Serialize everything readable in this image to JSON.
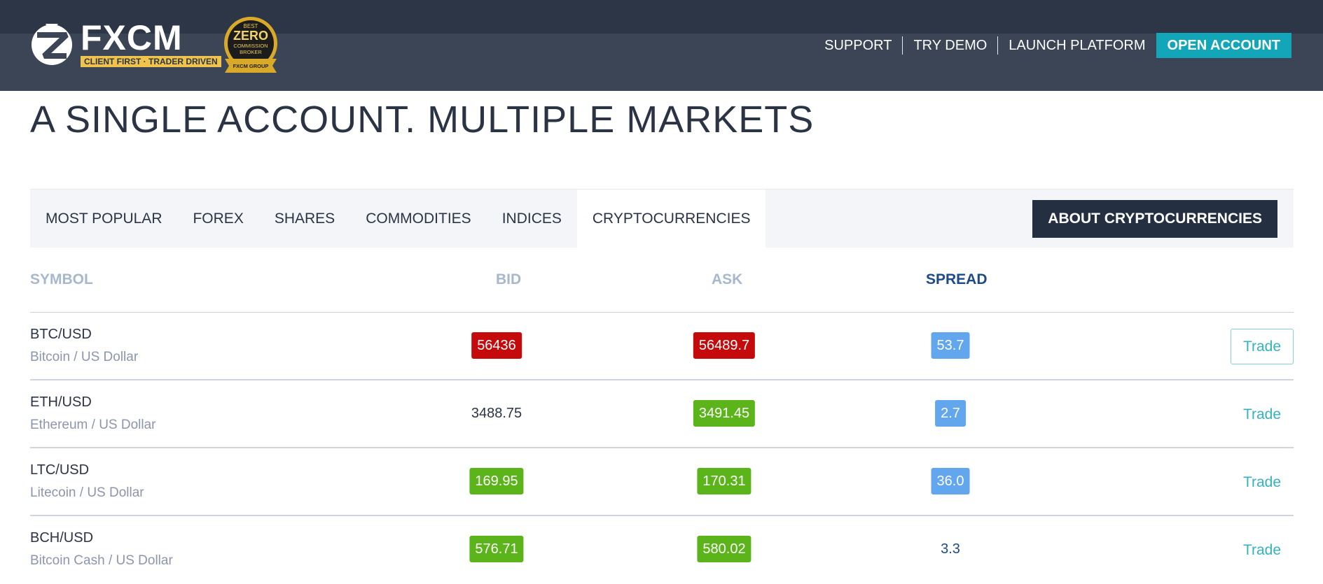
{
  "header": {
    "logo_text": "FXCM",
    "logo_tagline": "CLIENT FIRST · TRADER DRIVEN",
    "badge": {
      "line1": "BEST",
      "line2": "ZERO",
      "line3": "COMMISSION",
      "line4": "BROKER",
      "ribbon": "FXCM GROUP"
    },
    "nav": {
      "support": "SUPPORT",
      "try_demo": "TRY DEMO",
      "launch_platform": "LAUNCH PLATFORM",
      "open_account": "OPEN ACCOUNT"
    }
  },
  "page_title": "A SINGLE ACCOUNT. MULTIPLE MARKETS",
  "tabs": [
    {
      "label": "MOST POPULAR",
      "active": false
    },
    {
      "label": "FOREX",
      "active": false
    },
    {
      "label": "SHARES",
      "active": false
    },
    {
      "label": "COMMODITIES",
      "active": false
    },
    {
      "label": "INDICES",
      "active": false
    },
    {
      "label": "CRYPTOCURRENCIES",
      "active": true
    }
  ],
  "about_button": "ABOUT CRYPTOCURRENCIES",
  "table": {
    "columns": {
      "symbol": "SYMBOL",
      "bid": "BID",
      "ask": "ASK",
      "spread": "SPREAD"
    },
    "rows": [
      {
        "symbol": "BTC/USD",
        "name": "Bitcoin / US Dollar",
        "bid": "56436",
        "bid_state": "down",
        "ask": "56489.7",
        "ask_state": "down",
        "spread": "53.7",
        "spread_state": "highlight",
        "trade": "Trade",
        "trade_outlined": true
      },
      {
        "symbol": "ETH/USD",
        "name": "Ethereum / US Dollar",
        "bid": "3488.75",
        "bid_state": "none",
        "ask": "3491.45",
        "ask_state": "up",
        "spread": "2.7",
        "spread_state": "highlight",
        "trade": "Trade",
        "trade_outlined": false
      },
      {
        "symbol": "LTC/USD",
        "name": "Litecoin / US Dollar",
        "bid": "169.95",
        "bid_state": "up",
        "ask": "170.31",
        "ask_state": "up",
        "spread": "36.0",
        "spread_state": "highlight",
        "trade": "Trade",
        "trade_outlined": false
      },
      {
        "symbol": "BCH/USD",
        "name": "Bitcoin Cash / US Dollar",
        "bid": "576.71",
        "bid_state": "up",
        "ask": "580.02",
        "ask_state": "up",
        "spread": "3.3",
        "spread_state": "none",
        "trade": "Trade",
        "trade_outlined": false
      }
    ]
  },
  "colors": {
    "header_bg": "#3b4556",
    "accent_teal": "#13a5b8",
    "price_down": "#c40a0a",
    "price_up": "#5bb51a",
    "spread_highlight": "#62a6ee"
  }
}
